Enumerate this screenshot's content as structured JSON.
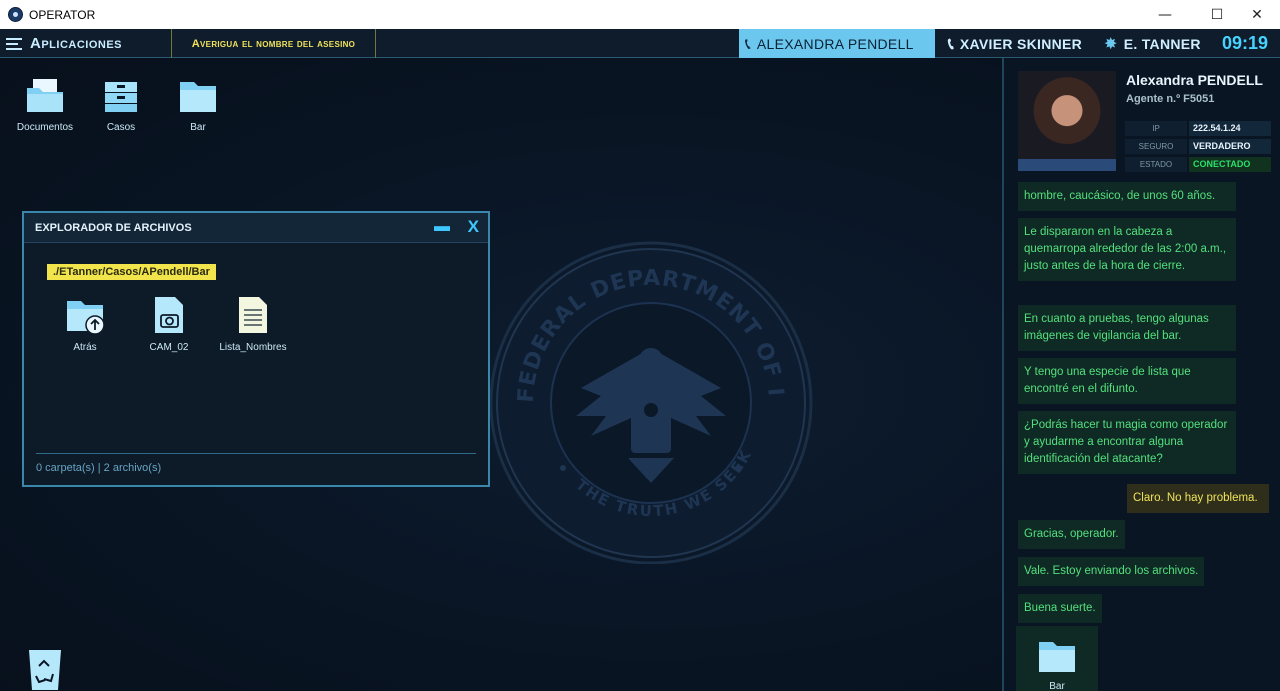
{
  "window": {
    "title": "OPERATOR",
    "minimize": "—",
    "maximize": "☐",
    "close": "✕"
  },
  "topbar": {
    "apps_label": "Aplicaciones",
    "mission": "Averigua el nombre del asesino",
    "contacts": [
      {
        "name": "ALEXANDRA PENDELL",
        "icon": "phone-icon",
        "active": true
      },
      {
        "name": "XAVIER SKINNER",
        "icon": "phone-icon",
        "active": false
      },
      {
        "name": "E. TANNER",
        "icon": "verified-badge-icon",
        "active": false
      }
    ],
    "clock": "09:19"
  },
  "desktop": {
    "icons": [
      {
        "label": "Documentos",
        "icon": "documents-folder-icon"
      },
      {
        "label": "Casos",
        "icon": "cases-drawer-icon"
      },
      {
        "label": "Bar",
        "icon": "folder-icon"
      }
    ],
    "seal": {
      "top_text": "FEDERAL DEPARTMENT OF INTELLIGENCE",
      "motto": "THE TRUTH WE SEEK"
    }
  },
  "explorer": {
    "title": "EXPLORADOR DE ARCHIVOS",
    "path": "./ETanner/Casos/APendell/Bar",
    "items": [
      {
        "label": "Atrás",
        "icon": "folder-up-icon"
      },
      {
        "label": "CAM_02",
        "icon": "camera-file-icon"
      },
      {
        "label": "Lista_Nombres",
        "icon": "text-document-icon"
      }
    ],
    "status": "0 carpeta(s) | 2 archivo(s)"
  },
  "agent": {
    "name": "Alexandra PENDELL",
    "id": "Agente n.º F5051",
    "ip_label": "IP",
    "ip_value": "222.54.1.24",
    "secure_label": "SEGURO",
    "secure_value": "VERDADERO",
    "state_label": "ESTADO",
    "state_value": "CONECTADO"
  },
  "chat": {
    "messages": [
      {
        "from": "agent",
        "text": "hombre, caucásico, de unos 60 años."
      },
      {
        "from": "agent",
        "text": "Le dispararon en la cabeza a quemarropa alrededor de las 2:00 a.m., justo antes de la hora de cierre."
      },
      {
        "from": "agent",
        "text": "En cuanto a pruebas, tengo algunas imágenes de vigilancia del bar."
      },
      {
        "from": "agent",
        "text": "Y tengo una especie de lista que encontré en el difunto."
      },
      {
        "from": "agent",
        "text": "¿Podrás hacer tu magia como operador y ayudarme a encontrar alguna identificación del atacante?"
      },
      {
        "from": "operator",
        "text": "Claro. No hay problema."
      },
      {
        "from": "agent",
        "text": "Gracias, operador."
      },
      {
        "from": "agent",
        "text": "Vale. Estoy enviando los archivos."
      },
      {
        "from": "agent",
        "text": "Buena suerte."
      }
    ],
    "attachment": {
      "label": "Bar",
      "icon": "folder-icon"
    }
  },
  "colors": {
    "accent": "#3fc7ff",
    "mission": "#f1e54b",
    "chat_agent": "#53e07c",
    "chat_operator": "#efe35a",
    "connected": "#2be16a"
  }
}
